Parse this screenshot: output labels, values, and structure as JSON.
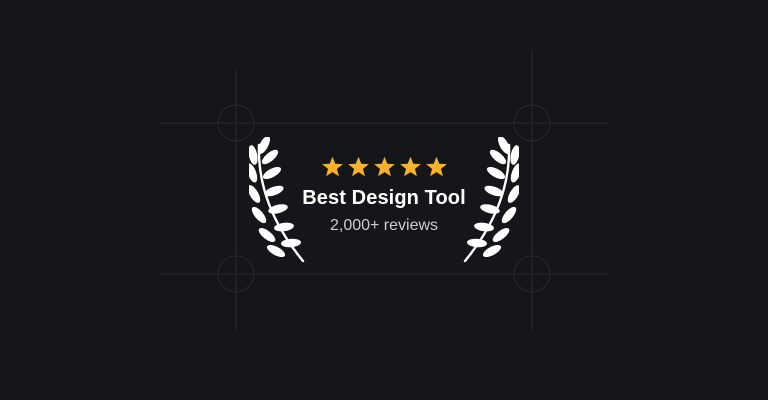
{
  "rating": {
    "stars_filled": 5,
    "stars_total": 5,
    "star_color": "#F7B12E"
  },
  "award": {
    "title": "Best Design Tool",
    "subtitle": "2,000+ reviews"
  },
  "colors": {
    "background": "#141619",
    "guide_line": "#262a30",
    "laurel": "#ffffff"
  },
  "icons": {
    "left": "laurel-left-icon",
    "right": "laurel-right-icon",
    "star": "star-icon"
  }
}
